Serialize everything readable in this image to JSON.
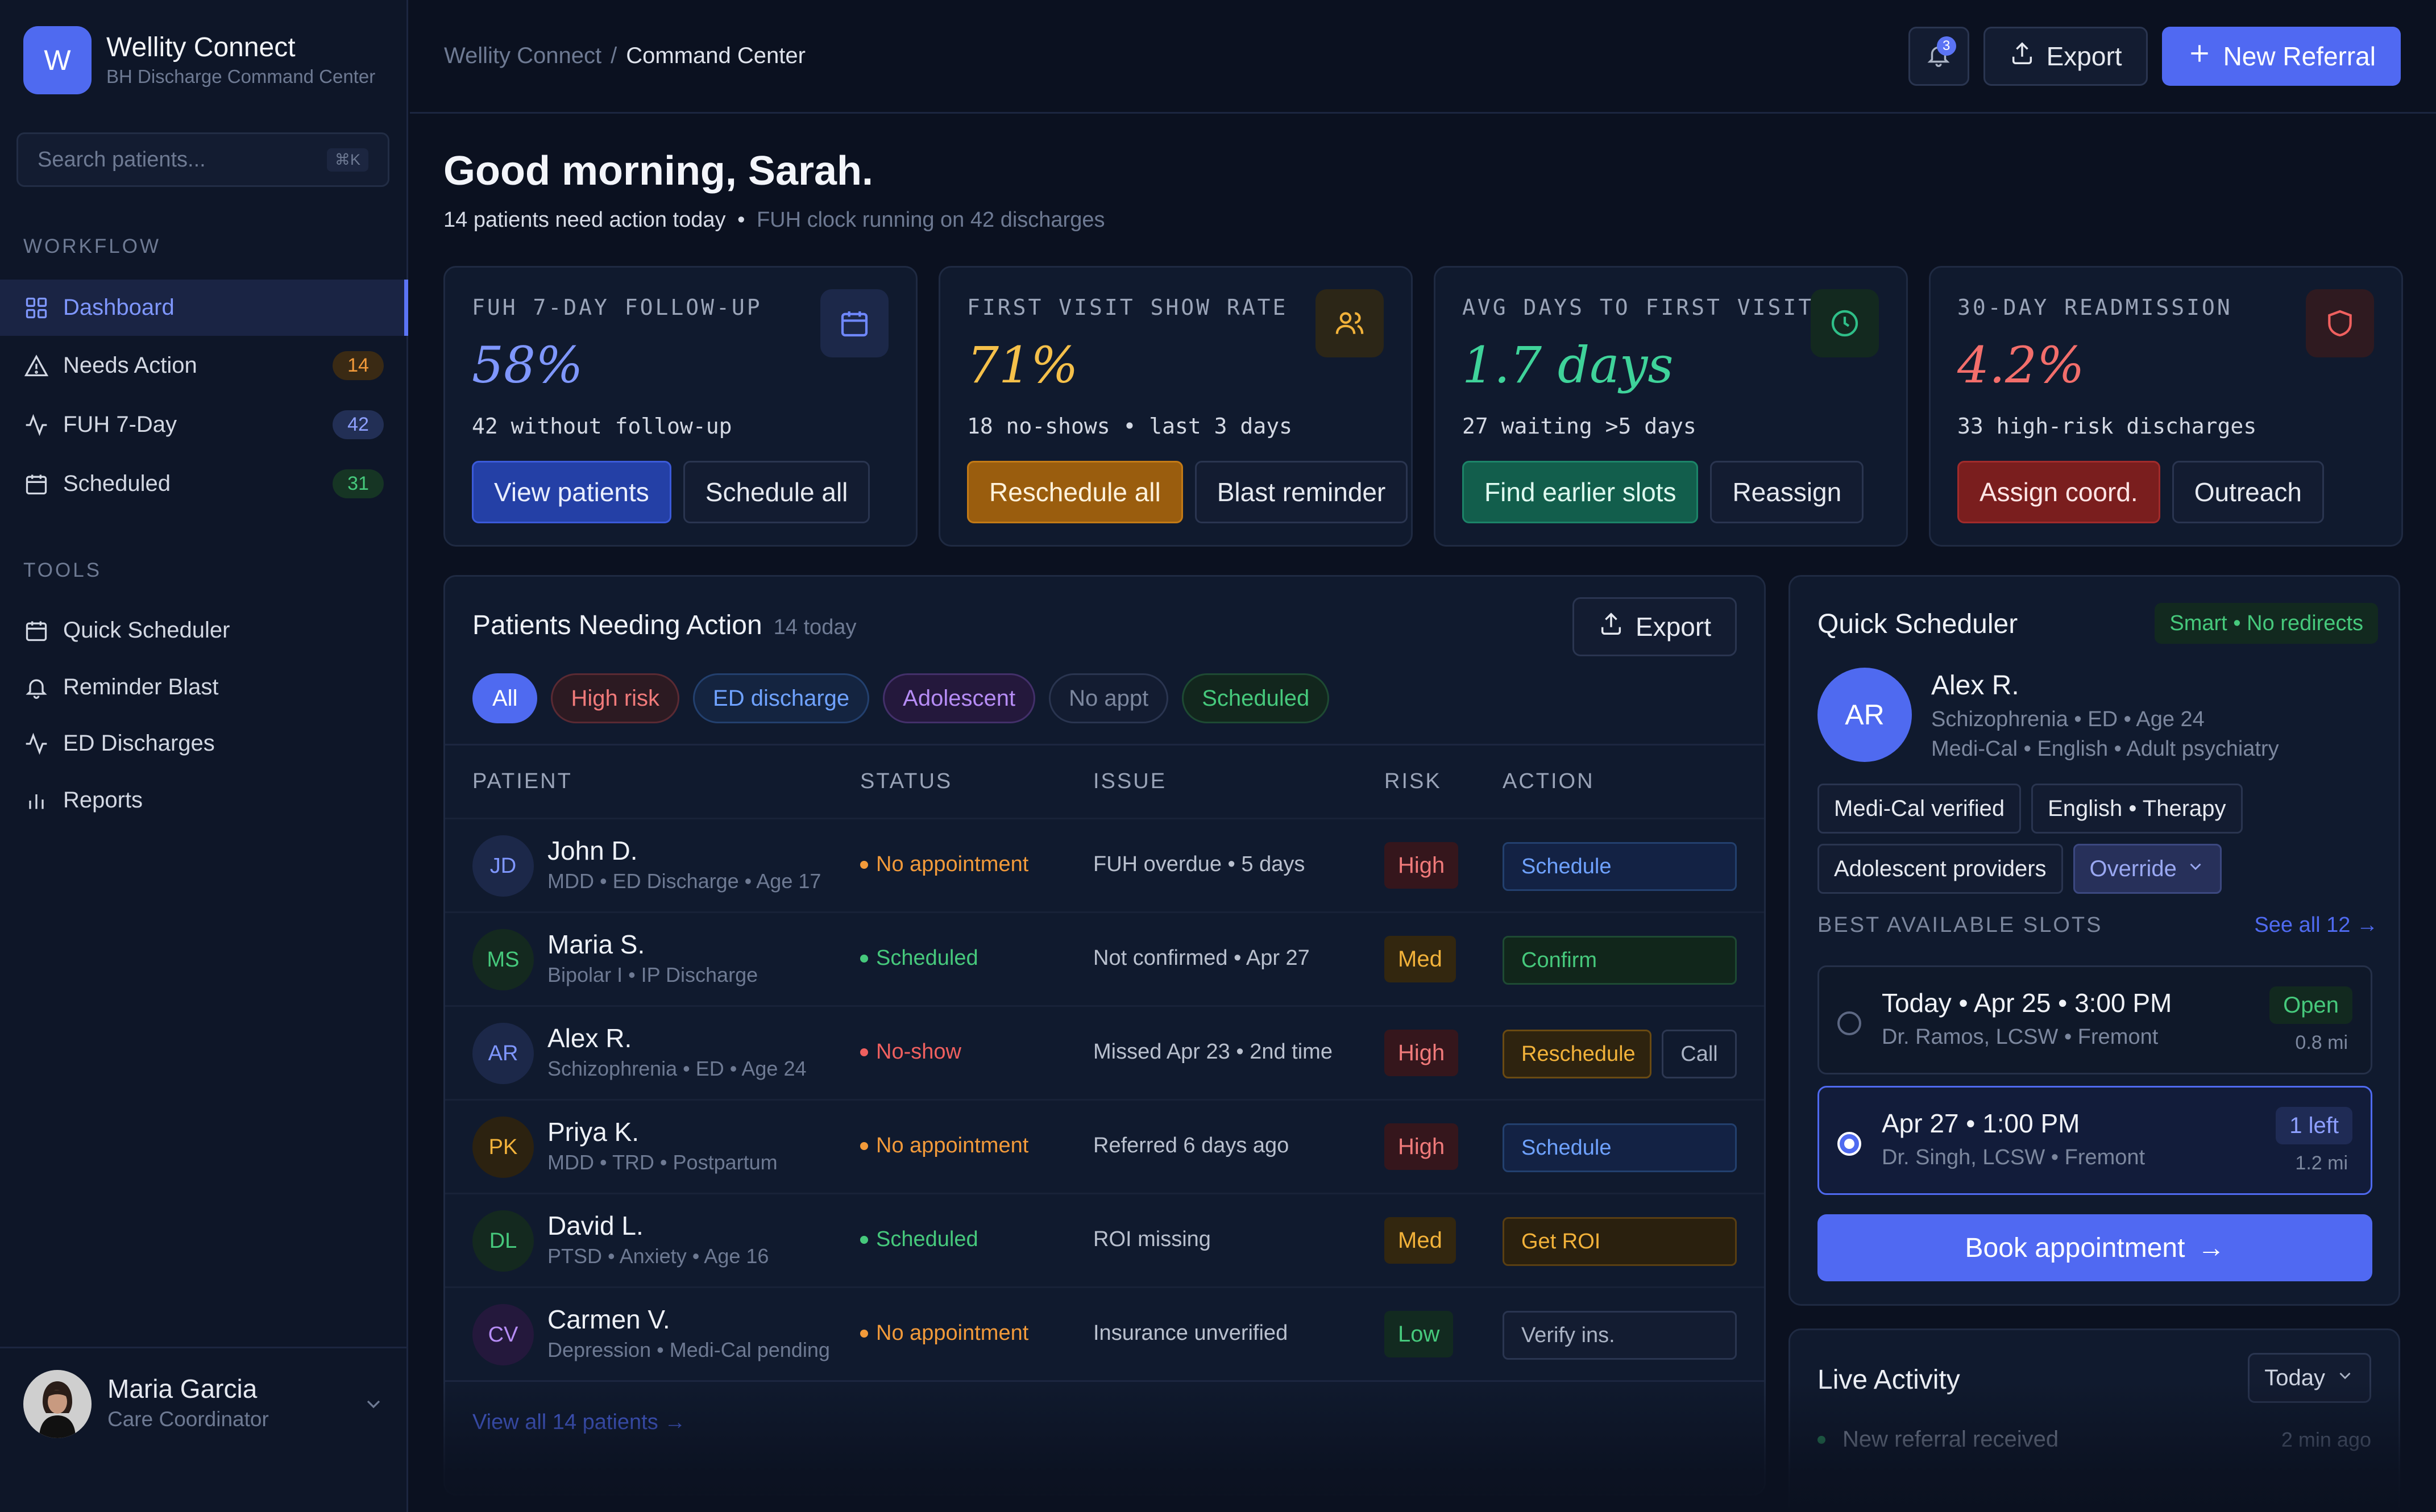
{
  "brand": {
    "logo_letter": "W",
    "name": "Wellity Connect",
    "subtitle": "BH Discharge Command Center"
  },
  "search": {
    "placeholder": "Search patients...",
    "shortcut": "⌘K"
  },
  "sidebar": {
    "workflow_heading": "WORKFLOW",
    "workflow": [
      {
        "label": "Dashboard",
        "icon": "grid-icon",
        "active": true
      },
      {
        "label": "Needs Action",
        "icon": "alert-triangle-icon",
        "badge": "14",
        "badge_color": "orange"
      },
      {
        "label": "FUH 7-Day",
        "icon": "activity-icon",
        "badge": "42",
        "badge_color": "blue"
      },
      {
        "label": "Scheduled",
        "icon": "calendar-icon",
        "badge": "31",
        "badge_color": "green"
      }
    ],
    "tools_heading": "TOOLS",
    "tools": [
      {
        "label": "Quick Scheduler",
        "icon": "calendar-icon"
      },
      {
        "label": "Reminder Blast",
        "icon": "bell-icon"
      },
      {
        "label": "ED Discharges",
        "icon": "activity-icon"
      },
      {
        "label": "Reports",
        "icon": "bar-chart-icon"
      }
    ]
  },
  "user": {
    "name": "Maria Garcia",
    "role": "Care Coordinator"
  },
  "breadcrumb": {
    "root": "Wellity Connect",
    "separator": "/",
    "current": "Command Center"
  },
  "topbar": {
    "notification_count": "3",
    "export_label": "Export",
    "new_referral_label": "New Referral"
  },
  "greeting": {
    "title": "Good morning, Sarah.",
    "summary": "14 patients need action today",
    "separator": "•",
    "detail": "FUH clock running on 42 discharges"
  },
  "kpis": [
    {
      "title": "FUH 7-DAY FOLLOW-UP",
      "value": "58%",
      "sub": "42 without follow-up",
      "icon": "calendar-icon",
      "accent": "#5b74f5",
      "actions": [
        "View patients",
        "Schedule all"
      ]
    },
    {
      "title": "FIRST VISIT SHOW RATE",
      "value": "71%",
      "sub": "18 no-shows • last 3 days",
      "icon": "users-icon",
      "accent": "#f2b23a",
      "actions": [
        "Reschedule all",
        "Blast reminder"
      ]
    },
    {
      "title": "AVG DAYS TO FIRST VISIT",
      "value": "1.7 days",
      "sub": "27 waiting >5 days",
      "icon": "clock-icon",
      "accent": "#2fbf88",
      "actions": [
        "Find earlier slots",
        "Reassign"
      ]
    },
    {
      "title": "30-DAY READMISSION",
      "value": "4.2%",
      "sub": "33 high-risk discharges",
      "icon": "shield-icon",
      "accent": "#f0605f",
      "actions": [
        "Assign coord.",
        "Outreach"
      ]
    }
  ],
  "patients_panel": {
    "title": "Patients Needing Action",
    "count": "14 today",
    "export_label": "Export",
    "filters": [
      "All",
      "High risk",
      "ED discharge",
      "Adolescent",
      "No appt",
      "Scheduled"
    ],
    "columns": [
      "PATIENT",
      "STATUS",
      "ISSUE",
      "RISK",
      "ACTION"
    ],
    "rows": [
      {
        "initials": "JD",
        "name": "John D.",
        "meta": "MDD • ED Discharge • Age 17",
        "status": "No appointment",
        "status_color": "#f29a3a",
        "issue": "FUH overdue • 5 days",
        "risk": "High",
        "action": "Schedule",
        "action_style": "blue"
      },
      {
        "initials": "MS",
        "name": "Maria S.",
        "meta": "Bipolar I • IP Discharge",
        "status": "Scheduled",
        "status_color": "#46c97c",
        "issue": "Not confirmed • Apr 27",
        "risk": "Med",
        "action": "Confirm",
        "action_style": "green"
      },
      {
        "initials": "AR",
        "name": "Alex R.",
        "meta": "Schizophrenia • ED • Age 24",
        "status": "No-show",
        "status_color": "#f0605f",
        "issue": "Missed Apr 23 • 2nd time",
        "risk": "High",
        "action": "Reschedule",
        "action_style": "amber",
        "secondary_action": "Call"
      },
      {
        "initials": "PK",
        "name": "Priya K.",
        "meta": "MDD • TRD • Postpartum",
        "status": "No appointment",
        "status_color": "#f29a3a",
        "issue": "Referred 6 days ago",
        "risk": "High",
        "action": "Schedule",
        "action_style": "blue"
      },
      {
        "initials": "DL",
        "name": "David L.",
        "meta": "PTSD • Anxiety • Age 16",
        "status": "Scheduled",
        "status_color": "#46c97c",
        "issue": "ROI missing",
        "risk": "Med",
        "action": "Get ROI",
        "action_style": "amber"
      },
      {
        "initials": "CV",
        "name": "Carmen V.",
        "meta": "Depression • Medi-Cal pending",
        "status": "No appointment",
        "status_color": "#f29a3a",
        "issue": "Insurance unverified",
        "risk": "Low",
        "action": "Verify ins.",
        "action_style": "neutral"
      }
    ],
    "view_all": "View all 14 patients →"
  },
  "quick_scheduler": {
    "title": "Quick Scheduler",
    "badge": "Smart • No redirects",
    "patient": {
      "initials": "AR",
      "name": "Alex R.",
      "meta1": "Schizophrenia • ED • Age 24",
      "meta2": "Medi-Cal • English • Adult psychiatry"
    },
    "tags": [
      "Medi-Cal verified",
      "English • Therapy",
      "Adolescent providers"
    ],
    "override_label": "Override",
    "slots_heading": "BEST AVAILABLE SLOTS",
    "see_all": "See all 12 →",
    "slots": [
      {
        "time": "Today • Apr 25 • 3:00 PM",
        "provider": "Dr. Ramos, LCSW • Fremont",
        "pill": "Open",
        "distance": "0.8 mi",
        "selected": false
      },
      {
        "time": "Apr 27 • 1:00 PM",
        "provider": "Dr. Singh, LCSW • Fremont",
        "pill": "1 left",
        "distance": "1.2 mi",
        "selected": true
      }
    ],
    "book_label": "Book appointment",
    "book_arrow": "→"
  },
  "live_activity": {
    "title": "Live Activity",
    "range": "Today",
    "items": [
      {
        "text": "New referral received",
        "time": "2 min ago"
      }
    ]
  }
}
